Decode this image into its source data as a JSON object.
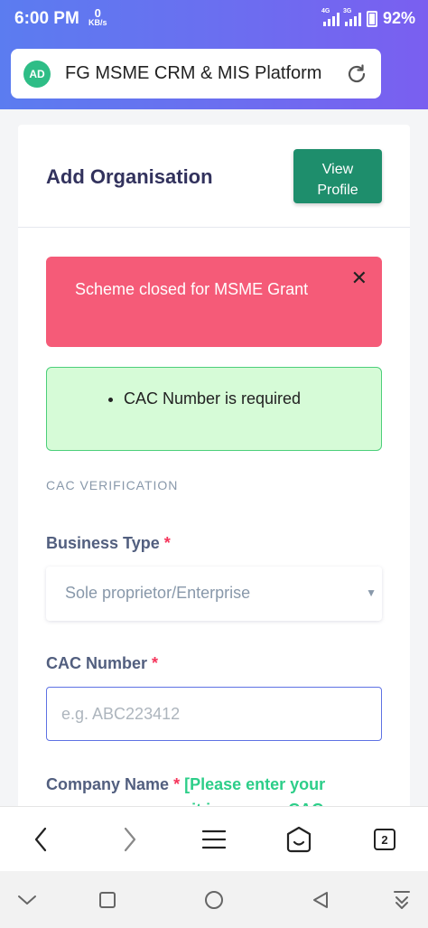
{
  "status": {
    "time": "6:00 PM",
    "speed_value": "0",
    "speed_unit": "KB/s",
    "net1": "4G",
    "net2": "3G",
    "battery": "92%"
  },
  "browser": {
    "logo_text": "AD",
    "page_title": "FG MSME CRM & MIS Platform",
    "tab_count": "2"
  },
  "card": {
    "title": "Add Organisation",
    "view_profile_line1": "View",
    "view_profile_line2": "Profile"
  },
  "alerts": {
    "danger_text": "Scheme closed for MSME Grant",
    "close_symbol": "✕",
    "success_item": "CAC Number is required"
  },
  "form": {
    "section_title": "CAC VERIFICATION",
    "business_type_label": "Business Type",
    "required_mark": "*",
    "business_type_value": "Sole proprietor/Enterprise",
    "cac_label": "CAC Number",
    "cac_placeholder": "e.g. ABC223412",
    "company_name_label": "Company Name",
    "company_name_hint": "[Please enter your company name as it is on your CAC"
  },
  "icons": {
    "reload": "reload-icon",
    "back": "chevron-left-icon",
    "forward": "chevron-right-icon",
    "menu": "hamburger-icon",
    "home": "home-icon",
    "sys_down": "chevron-down-icon",
    "sys_recent": "square-icon",
    "sys_home": "circle-icon",
    "sys_back": "triangle-back-icon",
    "sys_download": "download-icon"
  },
  "colors": {
    "header_gradient_start": "#5b7cf0",
    "header_gradient_end": "#7a5ff0",
    "button_green": "#1e8e6c",
    "danger": "#f55b78",
    "success_bg": "#d6fbd7",
    "required": "#f5365c",
    "hint_green": "#2dce89"
  }
}
